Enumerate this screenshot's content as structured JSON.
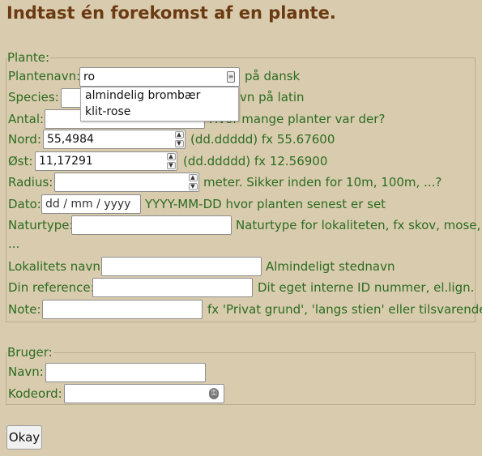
{
  "title": "Indtast én forekomst af en plante.",
  "plante_legend": "Plante:",
  "fields": {
    "plantenavn": {
      "label": "Plantenavn:",
      "value": "ro",
      "hint": "på dansk"
    },
    "species": {
      "label": "Species:",
      "hint": "vn på latin"
    },
    "antal": {
      "label": "Antal:",
      "hint": "Hvor mange planter var der?"
    },
    "nord": {
      "label": "Nord:",
      "value": "55,4984",
      "hint": "(dd.ddddd) fx 55.67600"
    },
    "oest": {
      "label": "Øst:",
      "value": "11,17291",
      "hint": "(dd.ddddd) fx 12.56900"
    },
    "radius": {
      "label": "Radius:",
      "hint": "meter. Sikker inden for 10m, 100m, ...?"
    },
    "dato": {
      "label": "Dato:",
      "placeholder": "dd / mm / yyyy",
      "hint": "YYYY-MM-DD hvor planten senest er set"
    },
    "naturtype": {
      "label": "Naturtype:",
      "hint": "Naturtype for lokaliteten, fx skov, mose,",
      "hint2": "..."
    },
    "lokalitet": {
      "label": "Lokalitets navn:",
      "hint": "Almindeligt stednavn"
    },
    "reference": {
      "label": "Din reference:",
      "hint": "Dit eget interne ID nummer, el.lign."
    },
    "note": {
      "label": "Note:",
      "hint": "fx 'Privat grund', 'langs stien' eller tilsvarende"
    }
  },
  "autocomplete": [
    "almindelig brombær",
    "klit-rose"
  ],
  "bruger_legend": "Bruger:",
  "bruger": {
    "navn": {
      "label": "Navn:"
    },
    "kodeord": {
      "label": "Kodeord:"
    }
  },
  "submit_label": "Okay",
  "colors": {
    "background": "#d9ccae",
    "label_text": "#2c6b21",
    "title_text": "#6b3a12"
  }
}
